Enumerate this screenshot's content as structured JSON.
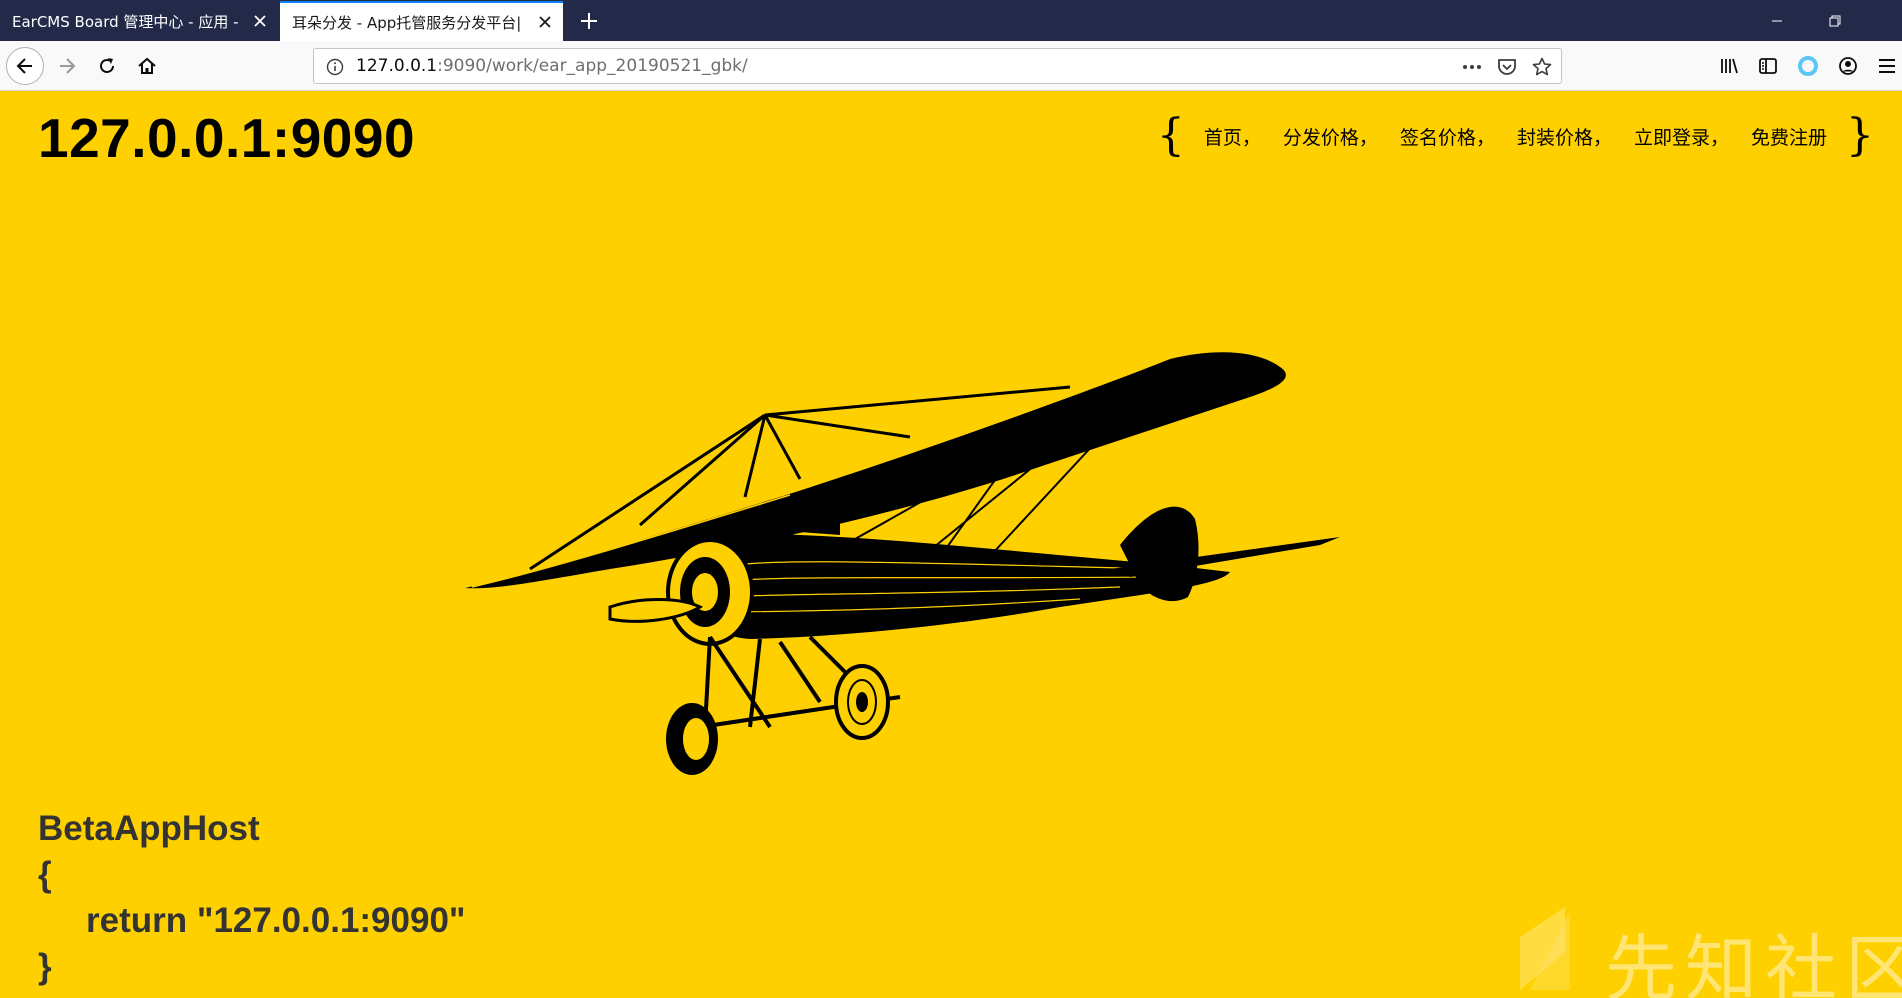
{
  "browser": {
    "tabs": [
      {
        "title": "EarCMS Board 管理中心 - 应用 - F"
      },
      {
        "title": "耳朵分发 - App托管服务分发平台|"
      }
    ],
    "url": {
      "host": "127.0.0.1",
      "rest": ":9090/work/ear_app_20190521_gbk/"
    },
    "accent": "#0a84ff"
  },
  "page": {
    "background": "#ffd000",
    "site_title": "127.0.0.1:9090",
    "nav": {
      "open_brace": "{",
      "close_brace": "}",
      "links": [
        "首页，",
        "分发价格，",
        "签名价格，",
        "封装价格，",
        "立即登录，",
        "免费注册"
      ]
    },
    "code": {
      "line1": "BetaAppHost",
      "line2": "{",
      "line3": "return \"127.0.0.1:9090\"",
      "line4": "}"
    },
    "watermark": "先知社区"
  }
}
